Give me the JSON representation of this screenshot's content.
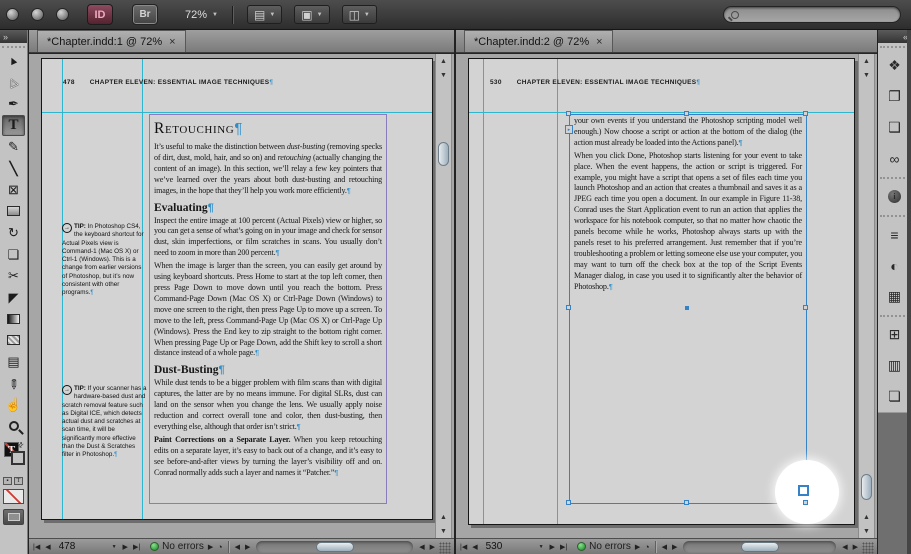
{
  "app_bar": {
    "id_button_label": "ID",
    "bridge_button_label": "Br",
    "zoom_level": "72%"
  },
  "glyphs": {
    "collapse_tools": "»",
    "collapse_dock": "«",
    "dropdown": "▼",
    "view_options_icon": "▤",
    "screen_mode_icon": "▣",
    "arrange_documents_icon": "◫",
    "tab_close": "×",
    "first_page": "|◀",
    "prev_page": "◀",
    "next_page": "▶",
    "last_page": "▶|",
    "scroll_up": "▲",
    "scroll_down": "▼",
    "scroll_left": "◀",
    "scroll_right": "▶",
    "preflight": "◔",
    "pilcrow": "¶",
    "inport": "▸",
    "tip_arrow": "→",
    "mini_container": "▪",
    "mini_text": "T",
    "swap": "⇄"
  },
  "tools": [
    {
      "name": "selection-tool",
      "glyph": "►",
      "cls": "sel-arrow"
    },
    {
      "name": "direct-selection-tool",
      "glyph": "▷",
      "cls": "dir-arrow"
    },
    {
      "name": "pen-tool",
      "glyph": "✒"
    },
    {
      "name": "type-tool",
      "glyph": "T",
      "cls": "type-glyph",
      "selected": true
    },
    {
      "name": "pencil-tool",
      "glyph": "✎"
    },
    {
      "name": "line-tool",
      "glyph": "╲",
      "cls": "line-glyph"
    },
    {
      "name": "frame-tool",
      "glyph": "⊠"
    },
    {
      "name": "rectangle-tool",
      "glyph": "",
      "cls": "box-plain"
    },
    {
      "name": "rotate-tool",
      "glyph": "↻"
    },
    {
      "name": "scale-tool",
      "glyph": "❏"
    },
    {
      "name": "scissors-tool",
      "glyph": "✂"
    },
    {
      "name": "position-tool",
      "glyph": "◤"
    },
    {
      "name": "gradient-swatch-tool",
      "glyph": "",
      "cls": "box-gradient"
    },
    {
      "name": "gradient-feather-tool",
      "glyph": "",
      "cls": "box-feather"
    },
    {
      "name": "note-tool",
      "glyph": "▤"
    },
    {
      "name": "eyedropper-tool",
      "glyph": "✐",
      "cls": "rot135"
    },
    {
      "name": "hand-tool",
      "glyph": "☝"
    },
    {
      "name": "zoom-tool",
      "glyph": "",
      "cls": "magnifier"
    }
  ],
  "dock_groups": [
    [
      {
        "name": "layers-panel-icon",
        "glyph": "❖"
      },
      {
        "name": "effects-panel-icon",
        "glyph": "❐"
      },
      {
        "name": "pages-panel-icon",
        "glyph": "❑"
      },
      {
        "name": "links-panel-icon",
        "glyph": "∞"
      }
    ],
    [
      {
        "name": "info-panel-icon",
        "glyph": "i",
        "cls": "circle-i"
      }
    ],
    [
      {
        "name": "stroke-panel-icon",
        "glyph": "≡"
      },
      {
        "name": "color-panel-icon",
        "glyph": "◐"
      },
      {
        "name": "swatches-panel-icon",
        "glyph": "▦"
      }
    ],
    [
      {
        "name": "table-panel-icon",
        "glyph": "⊞"
      },
      {
        "name": "paragraph-styles-panel-icon",
        "glyph": "▥"
      },
      {
        "name": "object-styles-panel-icon",
        "glyph": "❏"
      }
    ]
  ],
  "windows": [
    {
      "tab_label": "*Chapter.indd:1 @ 72%",
      "status": {
        "page_field": "478",
        "status_text": "No errors"
      },
      "page": {
        "folio": "478",
        "running_head": "CHAPTER ELEVEN: ESSENTIAL IMAGE TECHNIQUES",
        "blocks": [
          {
            "type": "h1",
            "runs": [
              {
                "t": "Retouching"
              },
              {
                "t": "¶",
                "c": "pilcrow"
              }
            ]
          },
          {
            "type": "p",
            "runs": [
              {
                "t": "It’s useful to make the distinction between "
              },
              {
                "t": "dust-busting",
                "i": true
              },
              {
                "t": " (removing specks of dirt, dust, mold, hair, and so on) and "
              },
              {
                "t": "retouching",
                "i": true
              },
              {
                "t": " (actually changing the content of an image). In this section, we’ll relay a few key pointers that we’ve learned over the years about both dust-busting and retouching images, in the hope that they’ll help you work more efficiently."
              },
              {
                "t": "¶",
                "c": "pilcrow"
              }
            ]
          },
          {
            "type": "h2",
            "runs": [
              {
                "t": "Evaluating"
              },
              {
                "t": "¶",
                "c": "pilcrow"
              }
            ]
          },
          {
            "type": "p",
            "runs": [
              {
                "t": "Inspect the entire image at 100 percent (Actual Pixels) view or higher, so you can get a sense of what’s going on in your image and check for sensor dust, skin imperfections, or film scratches in scans. You usually don’t need to zoom in more than 200 percent."
              },
              {
                "t": "¶",
                "c": "pilcrow"
              }
            ]
          },
          {
            "type": "p",
            "runs": [
              {
                "t": "When the image is larger than the screen, you can easily get around by using keyboard shortcuts. Press Home to start at the top left corner, then press Page Down to move down until you reach the bottom. Press Command-Page Down (Mac OS X) or Ctrl-Page Down (Windows) to move one screen to the right, then press Page Up to move up a screen. To move to the left, press Command-Page Up (Mac OS X) or Ctrl-Page Up (Windows). Press the End key to zip straight to the bottom right corner. When pressing Page Up or Page Down, add the Shift key to scroll a short distance instead of a whole page."
              },
              {
                "t": "¶",
                "c": "pilcrow"
              }
            ]
          },
          {
            "type": "h2",
            "runs": [
              {
                "t": "Dust-Busting"
              },
              {
                "t": "¶",
                "c": "pilcrow"
              }
            ]
          },
          {
            "type": "p",
            "runs": [
              {
                "t": "While dust tends to be a bigger problem with film scans than with digital captures, the latter are by no means immune. For digital SLRs, dust can land on the sensor when you change the lens. We usually apply noise reduction and correct overall tone and color, then dust-busting, then everything else, although that order isn’t strict."
              },
              {
                "t": "¶",
                "c": "pilcrow"
              }
            ]
          },
          {
            "type": "p",
            "runs": [
              {
                "t": "Paint Corrections on a Separate Layer.",
                "b": true
              },
              {
                "t": " When you keep retouching edits on a separate layer, it’s easy to back out of a change, and it’s easy to see before-and-after views by turning the layer’s visibility off and on. Conrad normally adds such a layer and names it “Patcher.”"
              },
              {
                "t": "¶",
                "c": "pilcrow"
              }
            ]
          }
        ],
        "tips": [
          {
            "label": "TIP:",
            "text": "In Photoshop CS4, the keyboard shortcut for Actual Pixels view is Command-1 (Mac OS X) or Ctrl-1 (Windows). This is a change from earlier versions of Photoshop, but it’s now consistent with other programs."
          },
          {
            "label": "TIP:",
            "text": "If your scanner has a hardware-based dust and scratch removal feature such as Digital ICE, which detects actual dust and scratches at scan time, it will be significantly more effective than the Dust & Scratches filter in Photoshop."
          }
        ]
      }
    },
    {
      "tab_label": "*Chapter.indd:2 @ 72%",
      "status": {
        "page_field": "530",
        "status_text": "No errors"
      },
      "page": {
        "folio": "530",
        "running_head": "CHAPTER ELEVEN: ESSENTIAL IMAGE TECHNIQUES",
        "blocks": [
          {
            "type": "p",
            "runs": [
              {
                "t": "your own events if you understand the Photoshop scripting model well enough.) Now choose a script or action at the bottom of the dialog (the action must already be loaded into the Actions panel)."
              },
              {
                "t": "¶",
                "c": "pilcrow"
              }
            ]
          },
          {
            "type": "p",
            "runs": [
              {
                "t": "When you click Done, Photoshop starts listening for your event to take place. When the event happens, the action or script is triggered. For example, you might have a script that opens a set of files each time you launch Photoshop and an action that creates a thumbnail and saves it as a JPEG each time you open a document. In our example in Figure 11-38, Conrad uses the Start Application event to run an action that applies the workspace for his notebook computer, so that no matter how chaotic the panels become while he works, Photoshop always starts up with the panels reset to his preferred arrangement. Just remember that if you’re troubleshooting a problem or letting someone else use your computer, you may want to turn off the check box at the top of the Script Events Manager dialog, in case you used it to significantly alter the behavior of Photoshop."
              },
              {
                "t": "¶",
                "c": "pilcrow"
              }
            ]
          }
        ]
      }
    }
  ]
}
